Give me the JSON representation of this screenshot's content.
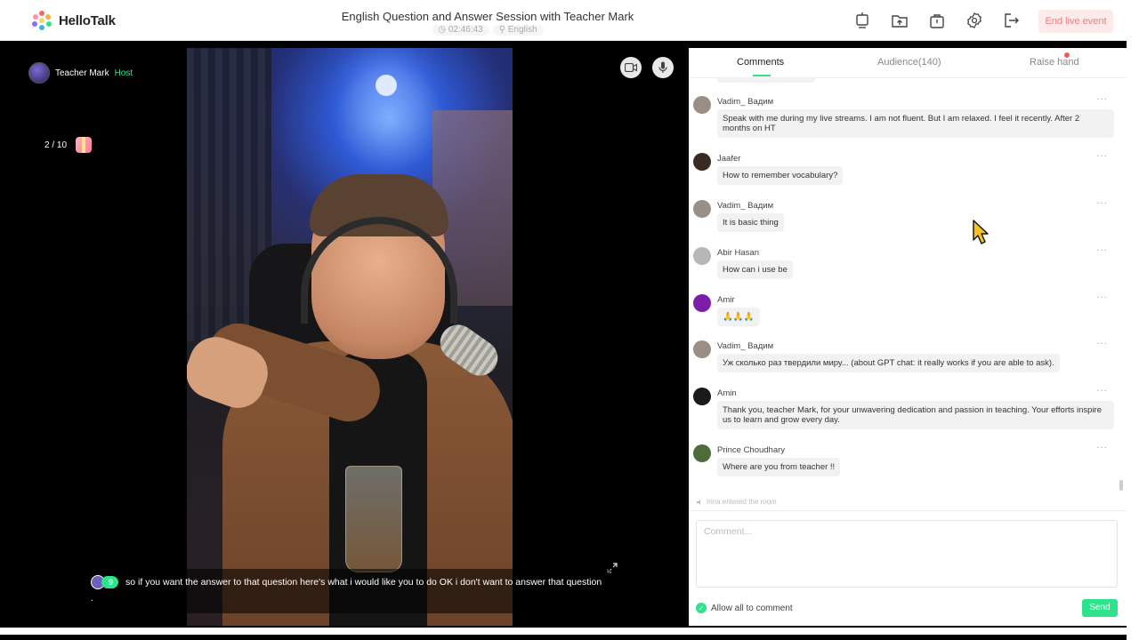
{
  "app": {
    "name": "HelloTalk"
  },
  "header": {
    "title": "English Question and Answer Session with Teacher Mark",
    "timer": "02:46:43",
    "language": "English",
    "end_label": "End live event",
    "icons": [
      "screen-share-icon",
      "folder-upload-icon",
      "bag-icon",
      "settings-icon",
      "exit-icon"
    ]
  },
  "video": {
    "host_name": "Teacher Mark",
    "host_tag": "Host",
    "counter": "2 / 10",
    "subtitle_count": "9",
    "subtitle_text": "so if you want the answer to that question here's what i would like you to do OK i don't want to answer that question ."
  },
  "tabs": {
    "comments": "Comments",
    "audience": "Audience(140)",
    "raise_hand": "Raise hand"
  },
  "comments": [
    {
      "name": "Vadim_ Вадим",
      "text": "Speak with me during my live streams. I am not fluent. But I am relaxed. I feel it recently. After 2 months on HT",
      "avatar_color": "#9a8f86"
    },
    {
      "name": "Jaafer",
      "text": "How to remember vocabulary?",
      "avatar_color": "#3a2a24"
    },
    {
      "name": "Vadim_ Вадим",
      "text": "It is basic thing",
      "avatar_color": "#9a8f86"
    },
    {
      "name": "Abir Hasan",
      "text": "How can i use be",
      "avatar_color": "#b7b7b7"
    },
    {
      "name": "Amir",
      "text": "🙏🙏🙏",
      "avatar_color": "#7c1fa8"
    },
    {
      "name": "Vadim_ Вадим",
      "text": "Уж сколько раз твердили миру... (about GPT chat: it really works if you are able to ask).",
      "avatar_color": "#9a8f86"
    },
    {
      "name": "Amin",
      "text": "Thank you, teacher Mark, for your unwavering dedication and passion in teaching. Your efforts inspire us to learn and grow every day.",
      "avatar_color": "#1a1a1a"
    },
    {
      "name": "Prince Choudhary",
      "text": "Where are you from teacher !!",
      "avatar_color": "#4f6b3a"
    }
  ],
  "enter_note": "Irina entered the room",
  "composer": {
    "placeholder": "Comment...",
    "allow_label": "Allow all to comment",
    "send_label": "Send"
  }
}
